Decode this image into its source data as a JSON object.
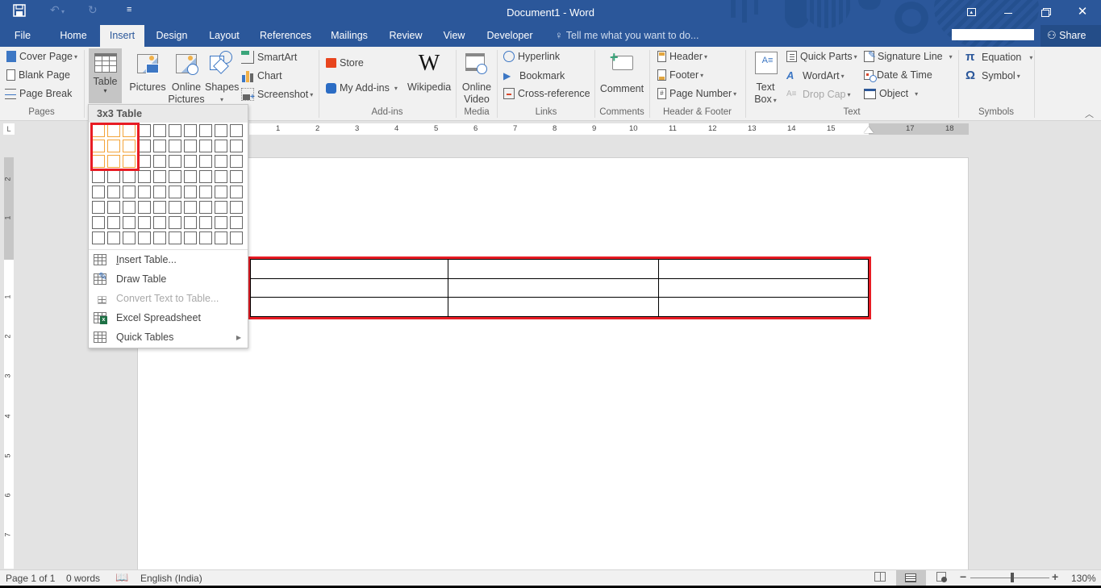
{
  "window": {
    "title": "Document1 - Word",
    "qat": {
      "save_icon": "save-icon",
      "undo_icon": "undo-icon",
      "redo_icon": "redo-icon",
      "customize_icon": "customize-qat-icon"
    },
    "controls": {
      "ribbon_display": "⬒",
      "minimize": "—",
      "restore": "❐",
      "close": "✕"
    }
  },
  "tabs": [
    {
      "label": "File",
      "active": false
    },
    {
      "label": "Home",
      "active": false
    },
    {
      "label": "Insert",
      "active": true
    },
    {
      "label": "Design",
      "active": false
    },
    {
      "label": "Layout",
      "active": false
    },
    {
      "label": "References",
      "active": false
    },
    {
      "label": "Mailings",
      "active": false
    },
    {
      "label": "Review",
      "active": false
    },
    {
      "label": "View",
      "active": false
    },
    {
      "label": "Developer",
      "active": false
    }
  ],
  "tell_me": {
    "placeholder": "Tell me what you want to do..."
  },
  "share": {
    "label": "Share"
  },
  "ribbon": {
    "pages": {
      "label": "Pages",
      "items": [
        "Cover Page",
        "Blank Page",
        "Page Break"
      ]
    },
    "tables": {
      "table_label": "Table"
    },
    "illustrations": {
      "pictures": "Pictures",
      "online_pictures_1": "Online",
      "online_pictures_2": "Pictures",
      "shapes": "Shapes",
      "smartart": "SmartArt",
      "chart": "Chart",
      "screenshot": "Screenshot"
    },
    "addins": {
      "label": "Add-ins",
      "store": "Store",
      "my_addins": "My Add-ins",
      "wikipedia": "Wikipedia"
    },
    "media": {
      "label": "Media",
      "online_video_1": "Online",
      "online_video_2": "Video"
    },
    "links": {
      "label": "Links",
      "hyperlink": "Hyperlink",
      "bookmark": "Bookmark",
      "cross_reference": "Cross-reference"
    },
    "comments": {
      "label": "Comments",
      "comment": "Comment"
    },
    "header_footer": {
      "label": "Header & Footer",
      "header": "Header",
      "footer": "Footer",
      "page_number": "Page Number"
    },
    "text": {
      "label": "Text",
      "text_box_1": "Text",
      "text_box_2": "Box",
      "quick_parts": "Quick Parts",
      "wordart": "WordArt",
      "drop_cap": "Drop Cap",
      "signature_line": "Signature Line",
      "date_time": "Date & Time",
      "object": "Object"
    },
    "symbols": {
      "label": "Symbols",
      "equation": "Equation",
      "symbol": "Symbol"
    }
  },
  "table_dropdown": {
    "header": "3x3 Table",
    "grid": {
      "columns": 10,
      "rows": 8,
      "selected_columns": 3,
      "selected_rows": 3
    },
    "menu": [
      {
        "label": "Insert Table...",
        "enabled": true
      },
      {
        "label": "Draw Table",
        "enabled": true
      },
      {
        "label": "Convert Text to Table...",
        "enabled": false
      },
      {
        "label": "Excel Spreadsheet",
        "enabled": true
      },
      {
        "label": "Quick Tables",
        "enabled": true,
        "submenu": true
      }
    ]
  },
  "ruler": {
    "horizontal_ticks": [
      "1",
      "2",
      "3",
      "4",
      "5",
      "6",
      "7",
      "8",
      "9",
      "10",
      "11",
      "12",
      "13",
      "14",
      "15",
      "17",
      "18"
    ],
    "vertical_ticks": [
      "2",
      "1",
      "1",
      "2",
      "3",
      "4",
      "5",
      "6",
      "7"
    ]
  },
  "document": {
    "table": {
      "rows": 3,
      "columns": 3
    }
  },
  "status": {
    "page": "Page 1 of 1",
    "words": "0 words",
    "language": "English (India)",
    "zoom": "130%",
    "zoom_minus": "−",
    "zoom_plus": "+"
  },
  "colors": {
    "title_bar": "#2b579a",
    "highlight": "#e81c24",
    "grid_hover": "#f3a43a"
  }
}
